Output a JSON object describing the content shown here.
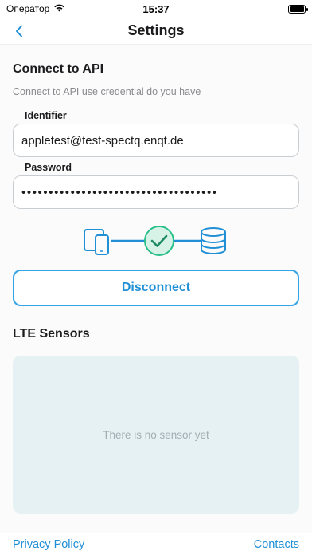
{
  "status_bar": {
    "carrier": "Оператор",
    "time": "15:37"
  },
  "nav": {
    "title": "Settings"
  },
  "api": {
    "title": "Connect to API",
    "subtitle": "Connect to API use credential do you have",
    "identifier_label": "Identifier",
    "identifier_value": "appletest@test-spectq.enqt.de",
    "password_label": "Password",
    "password_value": "••••••••••••••••••••••••••••••••••••",
    "status": "connected",
    "disconnect_label": "Disconnect"
  },
  "sensors": {
    "title": "LTE Sensors",
    "empty_text": "There is no sensor yet"
  },
  "footer": {
    "privacy_label": "Privacy Policy",
    "contacts_label": "Contacts"
  },
  "colors": {
    "accent": "#1f8fd6",
    "success": "#2bbf8a",
    "panel": "#e6f1f4"
  }
}
